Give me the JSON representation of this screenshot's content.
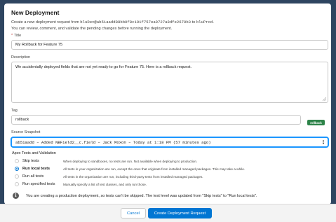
{
  "modal": {
    "title": "New Deployment",
    "desc_line1_prefix": "Create a new deployment request from ",
    "desc_source": "bluDev@ab51aadd88bb0f8c191f757ea9727a8dfe2670b3",
    "desc_to": " to ",
    "desc_target": "bluProd",
    "desc_line1_suffix": ".",
    "desc_line2": "You can review, comment, and validate the pending changes before running the deployment."
  },
  "form": {
    "title_label": "Title",
    "title_value": "My Rollback for Feature 75",
    "description_label": "Description",
    "description_value": "We accidentally deployed fields that are not yet ready to go for Feature 75. Here is a rollback request.",
    "tag_label": "Tag",
    "tag_value": "rollback",
    "tag_badge": "rollback",
    "snapshot_label": "Source Snapshot",
    "snapshot_value": "ab51aadd – Added NBField2__c.field – Jack Moxon – Today at 1:18 PM (57 minutes ago)"
  },
  "apex": {
    "section_title": "Apex Tests and Validation",
    "options": [
      {
        "label": "Skip tests",
        "desc": "When deploying to sandboxes, no tests are run. Not available when deploying to production.",
        "selected": false
      },
      {
        "label": "Run local tests",
        "desc": "All tests in your organization are run, except the ones that originate from installed managed packages. This may take a while.",
        "selected": true
      },
      {
        "label": "Run all tests",
        "desc": "All tests in the organization are run, including third-party tests from installed managed packages.",
        "selected": false
      },
      {
        "label": "Run specified tests",
        "desc": "Manually specify a list of test classes, and only run those.",
        "selected": false
      }
    ],
    "notice": "You are creating a production deployment, so tests can't be skipped. The test level was updated from \"Skip tests\" to \"Run local tests\"."
  },
  "footer": {
    "cancel_label": "Cancel",
    "create_label": "Create Deployment Request"
  },
  "colors": {
    "brand": "#0176d3",
    "tag_badge": "#2e844a",
    "backdrop": "#2e4560"
  },
  "icons": {
    "required": "asterisk",
    "info": "info-icon",
    "select": "up-down-arrows-icon"
  }
}
